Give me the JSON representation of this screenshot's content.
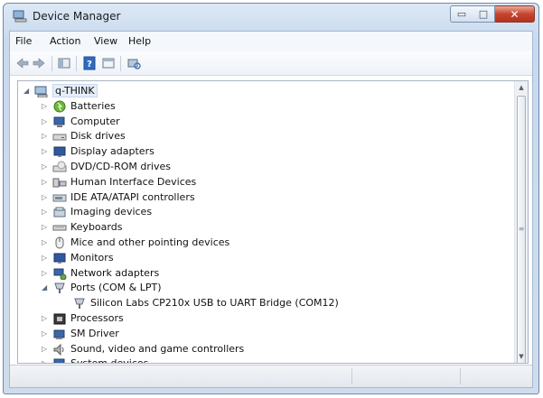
{
  "window": {
    "title": "Device Manager"
  },
  "window_controls": {
    "minimize": "▭",
    "maximize": "□",
    "close": "✕"
  },
  "menubar": {
    "items": [
      "File",
      "Action",
      "View",
      "Help"
    ]
  },
  "toolbar": {
    "icons": [
      "back-icon",
      "forward-icon",
      "properties-icon",
      "help-icon",
      "view-icon",
      "scan-hardware-icon"
    ]
  },
  "tree": {
    "root": {
      "label": "q-THINK",
      "expanded": true,
      "icon": "computer-root-icon"
    },
    "items": [
      {
        "label": "Batteries",
        "icon": "battery-icon",
        "expanded": false
      },
      {
        "label": "Computer",
        "icon": "computer-icon",
        "expanded": false
      },
      {
        "label": "Disk drives",
        "icon": "disk-drive-icon",
        "expanded": false
      },
      {
        "label": "Display adapters",
        "icon": "display-adapter-icon",
        "expanded": false
      },
      {
        "label": "DVD/CD-ROM drives",
        "icon": "dvd-drive-icon",
        "expanded": false
      },
      {
        "label": "Human Interface Devices",
        "icon": "hid-icon",
        "expanded": false
      },
      {
        "label": "IDE ATA/ATAPI controllers",
        "icon": "ide-controller-icon",
        "expanded": false
      },
      {
        "label": "Imaging devices",
        "icon": "imaging-icon",
        "expanded": false
      },
      {
        "label": "Keyboards",
        "icon": "keyboard-icon",
        "expanded": false
      },
      {
        "label": "Mice and other pointing devices",
        "icon": "mouse-icon",
        "expanded": false
      },
      {
        "label": "Monitors",
        "icon": "monitor-icon",
        "expanded": false
      },
      {
        "label": "Network adapters",
        "icon": "network-icon",
        "expanded": false
      },
      {
        "label": "Ports (COM & LPT)",
        "icon": "port-icon",
        "expanded": true,
        "children": [
          {
            "label": "Silicon Labs CP210x USB to UART Bridge (COM12)",
            "icon": "port-icon"
          }
        ]
      },
      {
        "label": "Processors",
        "icon": "processor-icon",
        "expanded": false
      },
      {
        "label": "SM Driver",
        "icon": "driver-icon",
        "expanded": false
      },
      {
        "label": "Sound, video and game controllers",
        "icon": "sound-icon",
        "expanded": false
      },
      {
        "label": "System devices",
        "icon": "system-device-icon",
        "expanded": false
      }
    ]
  },
  "scrollbar": {
    "up": "▲",
    "down": "▼",
    "grip": "≡"
  },
  "colors": {
    "accent": "#3a78c9",
    "close_button": "#c7452f"
  }
}
